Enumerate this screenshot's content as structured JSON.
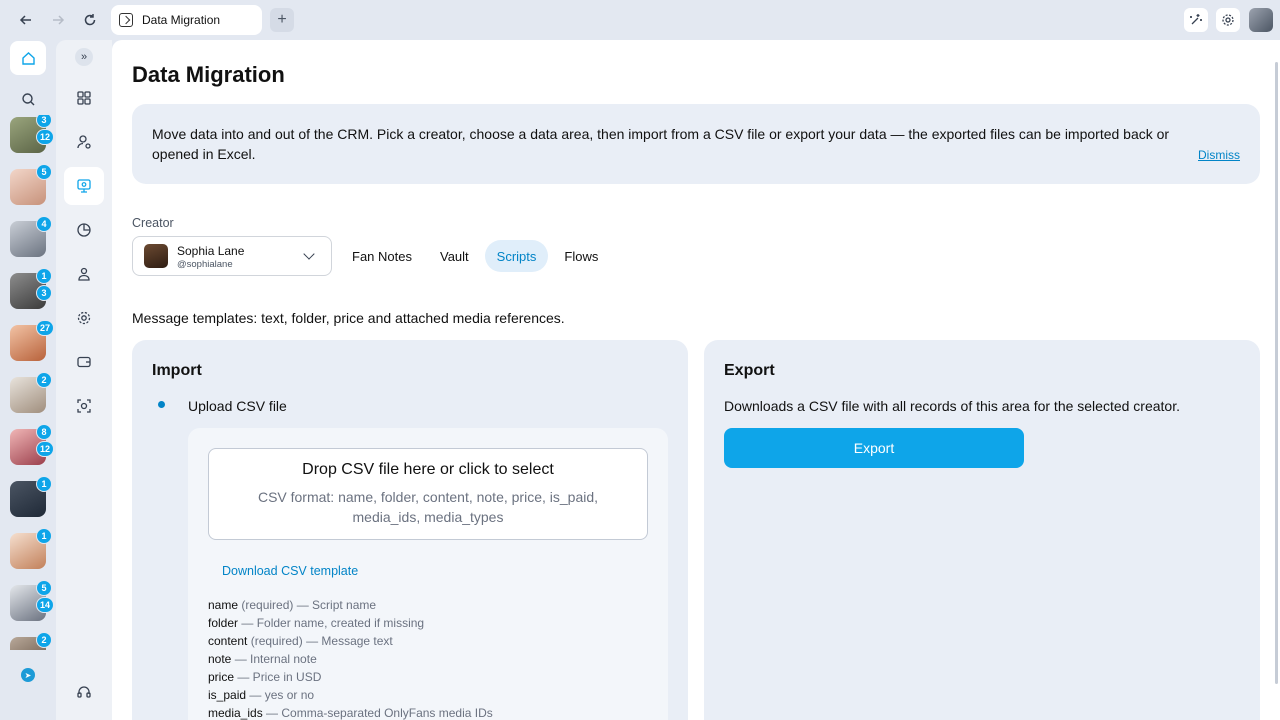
{
  "browser": {
    "tab_title": "Data Migration",
    "new_tab_label": "+"
  },
  "rail": {
    "avatars": [
      {
        "badges": [
          "3",
          "12"
        ],
        "colors": [
          "#9aa57d",
          "#5b6446"
        ]
      },
      {
        "badges": [
          "5"
        ],
        "colors": [
          "#f2d6c9",
          "#c7927b"
        ]
      },
      {
        "badges": [
          "4"
        ],
        "colors": [
          "#c9ced6",
          "#6b7380"
        ]
      },
      {
        "badges": [
          "1",
          "3"
        ],
        "colors": [
          "#8d8d8d",
          "#3b3b3b"
        ]
      },
      {
        "badges": [
          "27"
        ],
        "colors": [
          "#f2c3a5",
          "#b8623b"
        ]
      },
      {
        "badges": [
          "2"
        ],
        "colors": [
          "#e8e3dc",
          "#a08e7d"
        ]
      },
      {
        "badges": [
          "8",
          "12"
        ],
        "colors": [
          "#f0b6b6",
          "#9b3f4c"
        ]
      },
      {
        "badges": [
          "1"
        ],
        "colors": [
          "#4b5563",
          "#1f2937"
        ]
      },
      {
        "badges": [
          "1"
        ],
        "colors": [
          "#f5dfcf",
          "#c2805a"
        ]
      },
      {
        "badges": [
          "5",
          "14"
        ],
        "colors": [
          "#e4e7eb",
          "#6b7280"
        ]
      },
      {
        "badges": [
          "2"
        ],
        "colors": [
          "#b9a99a",
          "#5c4a3c"
        ]
      }
    ]
  },
  "page": {
    "title": "Data Migration",
    "info_text": "Move data into and out of the CRM. Pick a creator, choose a data area, then import from a CSV file or export your data — the exported files can be imported back or opened in Excel.",
    "dismiss_label": "Dismiss"
  },
  "creator": {
    "label": "Creator",
    "name": "Sophia Lane",
    "handle": "@sophialane"
  },
  "area_tabs": [
    {
      "label": "Fan Notes",
      "active": false
    },
    {
      "label": "Vault",
      "active": false
    },
    {
      "label": "Scripts",
      "active": true
    },
    {
      "label": "Flows",
      "active": false
    }
  ],
  "area_description": "Message templates: text, folder, price and attached media references.",
  "import": {
    "title": "Import",
    "option_label": "Upload CSV file",
    "drop_title": "Drop CSV file here or click to select",
    "drop_format": "CSV format: name, folder, content, note, price, is_paid, media_ids, media_types",
    "template_link": "Download CSV template",
    "fields": [
      {
        "name": "name",
        "desc": " (required) — Script name"
      },
      {
        "name": "folder",
        "desc": " — Folder name, created if missing"
      },
      {
        "name": "content",
        "desc": " (required) — Message text"
      },
      {
        "name": "note",
        "desc": " — Internal note"
      },
      {
        "name": "price",
        "desc": " — Price in USD"
      },
      {
        "name": "is_paid",
        "desc": " — yes or no"
      },
      {
        "name": "media_ids",
        "desc": " — Comma-separated OnlyFans media IDs"
      }
    ]
  },
  "export": {
    "title": "Export",
    "description": "Downloads a CSV file with all records of this area for the selected creator.",
    "button_label": "Export"
  },
  "colors": {
    "accent": "#0ea5e9",
    "link": "#0284c7",
    "panel": "#e9eef6",
    "background": "#e3e8f1"
  }
}
